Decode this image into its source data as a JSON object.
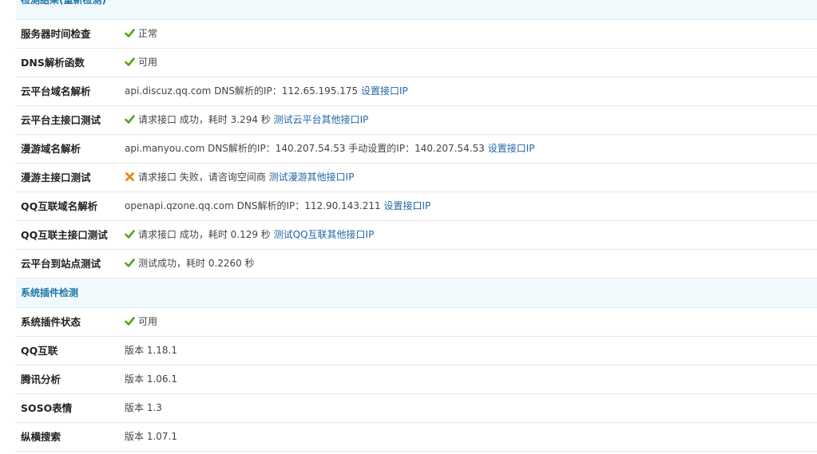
{
  "section_results": {
    "title": "检测结果(重新检测)"
  },
  "rows_a": [
    {
      "label": "服务器时间检查",
      "status": "ok",
      "text": "正常",
      "link": ""
    },
    {
      "label": "DNS解析函数",
      "status": "ok",
      "text": "可用",
      "link": ""
    },
    {
      "label": "云平台域名解析",
      "status": "none",
      "text": "api.discuz.qq.com DNS解析的IP：112.65.195.175",
      "link": "设置接口IP"
    },
    {
      "label": "云平台主接口测试",
      "status": "ok",
      "text": "请求接口 成功，耗时 3.294 秒",
      "link": "测试云平台其他接口IP"
    },
    {
      "label": "漫游域名解析",
      "status": "none",
      "text": "api.manyou.com DNS解析的IP：140.207.54.53 手动设置的IP：140.207.54.53",
      "link": "设置接口IP"
    },
    {
      "label": "漫游主接口测试",
      "status": "error",
      "text": "请求接口 失败，请咨询空间商",
      "link": "测试漫游其他接口IP"
    },
    {
      "label": "QQ互联域名解析",
      "status": "none",
      "text": "openapi.qzone.qq.com DNS解析的IP：112.90.143.211",
      "link": "设置接口IP"
    },
    {
      "label": "QQ互联主接口测试",
      "status": "ok",
      "text": "请求接口 成功，耗时 0.129 秒",
      "link": "测试QQ互联其他接口IP"
    },
    {
      "label": "云平台到站点测试",
      "status": "ok",
      "text": "测试成功，耗时 0.2260 秒",
      "link": ""
    }
  ],
  "section_plugins": {
    "title": "系统插件检测"
  },
  "rows_b": [
    {
      "label": "系统插件状态",
      "status": "ok",
      "text": "可用",
      "link": ""
    },
    {
      "label": "QQ互联",
      "status": "none",
      "text": "版本 1.18.1",
      "link": ""
    },
    {
      "label": "腾讯分析",
      "status": "none",
      "text": "版本 1.06.1",
      "link": ""
    },
    {
      "label": "SOSO表情",
      "status": "none",
      "text": "版本 1.3",
      "link": ""
    },
    {
      "label": "纵横搜索",
      "status": "none",
      "text": "版本 1.07.1",
      "link": ""
    }
  ],
  "icons": {
    "ok": "check-icon",
    "error": "cross-icon"
  },
  "colors": {
    "ok": "#52a41a",
    "error": "#e8870e",
    "link": "#2366a8",
    "section_title": "#1a77a6",
    "section_bg": "#f2f9fd"
  }
}
